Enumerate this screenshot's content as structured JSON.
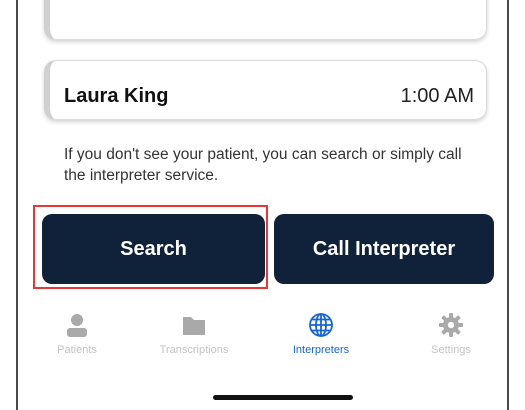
{
  "patients": [
    {
      "name": "Laura King",
      "time": "1:00 AM"
    }
  ],
  "hint": "If you don't see your patient, you can search or simply call the interpreter service.",
  "buttons": {
    "search": "Search",
    "call": "Call Interpreter"
  },
  "tabs": [
    {
      "label": "Patients",
      "icon": "person-icon",
      "active": false
    },
    {
      "label": "Transcriptions",
      "icon": "folder-icon",
      "active": false
    },
    {
      "label": "Interpreters",
      "icon": "globe-icon",
      "active": true
    },
    {
      "label": "Settings",
      "icon": "gear-icon",
      "active": false
    }
  ],
  "colors": {
    "primary_button": "#0f2239",
    "active_tab": "#1565d8",
    "inactive_tab": "#c3c3c3",
    "highlight": "#e53935"
  }
}
